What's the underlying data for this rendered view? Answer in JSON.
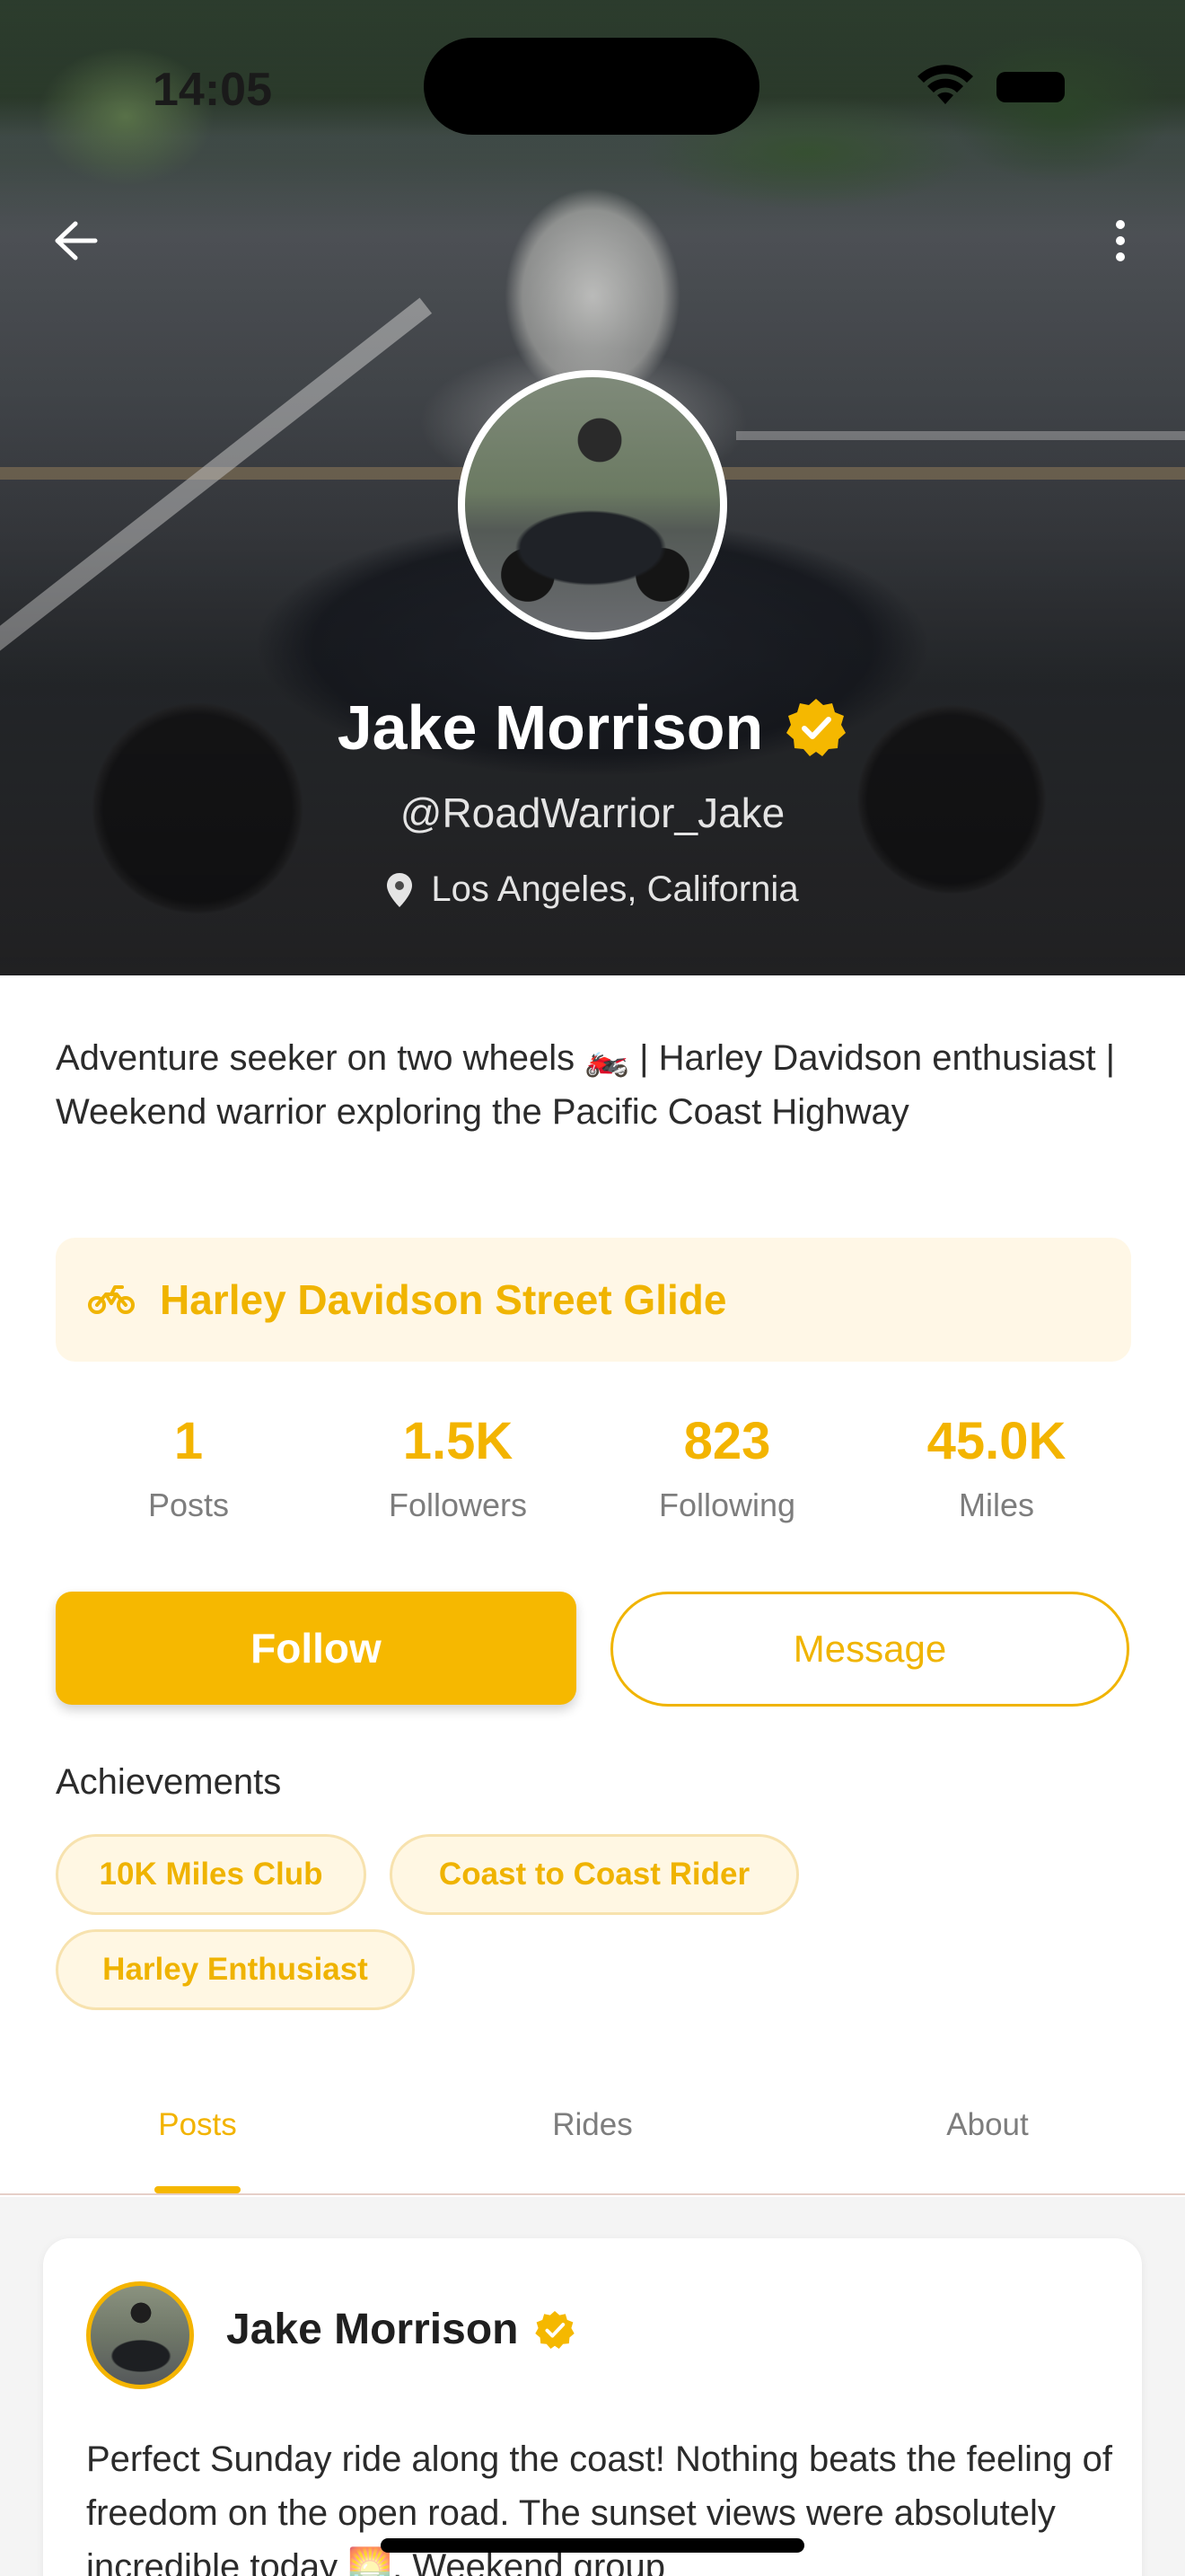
{
  "status_bar": {
    "time": "14:05"
  },
  "profile": {
    "name": "Jake Morrison",
    "handle": "@RoadWarrior_Jake",
    "location": "Los Angeles, California",
    "bio": "Adventure seeker on two wheels 🏍️ | Harley Davidson enthusiast | Weekend warrior exploring the Pacific Coast Highway",
    "motorcycle": "Harley Davidson Street Glide"
  },
  "stats": [
    {
      "value": "1",
      "label": "Posts"
    },
    {
      "value": "1.5K",
      "label": "Followers"
    },
    {
      "value": "823",
      "label": "Following"
    },
    {
      "value": "45.0K",
      "label": "Miles"
    }
  ],
  "actions": {
    "follow_label": "Follow",
    "message_label": "Message"
  },
  "achievements": {
    "title": "Achievements",
    "items": [
      "10K Miles Club",
      "Coast to Coast Rider",
      "Harley Enthusiast"
    ]
  },
  "tabs": [
    {
      "label": "Posts",
      "active": true
    },
    {
      "label": "Rides",
      "active": false
    },
    {
      "label": "About",
      "active": false
    }
  ],
  "post": {
    "author": "Jake Morrison",
    "text": "Perfect Sunday ride along the coast! Nothing beats the feeling of freedom on the open road. The sunset views were absolutely incredible today 🌅. Weekend group"
  },
  "colors": {
    "accent": "#F5B800",
    "accent_light": "#FFF7E6",
    "text": "#2B2B2B",
    "muted": "#7D7D7D"
  },
  "icons": {
    "back": "arrow-left-icon",
    "more": "more-vertical-icon",
    "verified": "verified-badge-icon",
    "location": "location-pin-icon",
    "motorcycle": "motorcycle-icon"
  }
}
